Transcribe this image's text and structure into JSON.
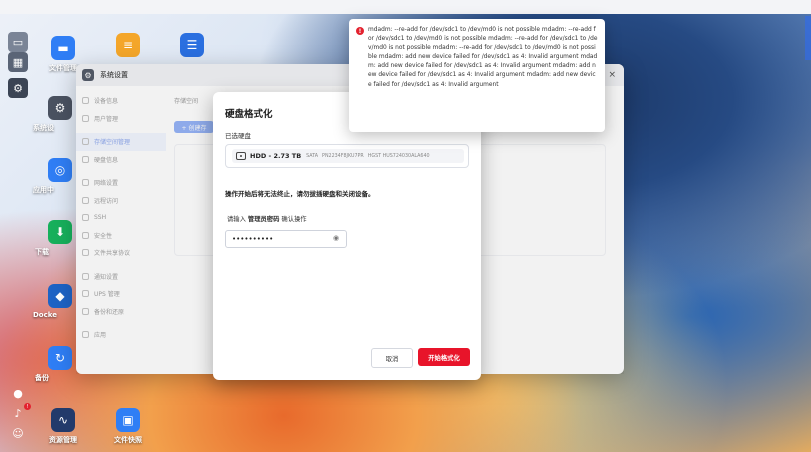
{
  "desktop": {
    "icons": [
      {
        "label": "文件管理",
        "icon": "folder-icon",
        "color": "#2f7ef5"
      },
      {
        "label": "",
        "icon": "notes-icon",
        "color": "#f4a62a"
      },
      {
        "label": "",
        "icon": "server-icon",
        "color": "#2a6fe0"
      },
      {
        "label": "系统设",
        "icon": "gear-icon",
        "color": "#4a5261"
      },
      {
        "label": "应用中",
        "icon": "store-icon",
        "color": "#2f7ef5"
      },
      {
        "label": "下载",
        "icon": "download-icon",
        "color": "#17b05c"
      },
      {
        "label": "Docke",
        "icon": "docker-icon",
        "color": "#1e63c5"
      },
      {
        "label": "备份",
        "icon": "backup-icon",
        "color": "#2f7ef5"
      },
      {
        "label": "资源管理",
        "icon": "monitor-icon",
        "color": "#223a6b"
      },
      {
        "label": "文件快照",
        "icon": "snapshot-icon",
        "color": "#2f7ef5"
      }
    ]
  },
  "window": {
    "title": "系统设置",
    "close": "×",
    "nav": [
      "设备信息",
      "用户管理",
      "存储空间管理",
      "硬盘信息",
      "网络设置",
      "远程访问",
      "SSH",
      "安全性",
      "文件共享协议",
      "通知设置",
      "UPS 管理",
      "备份和还原",
      "应用"
    ],
    "tab": "存储空间",
    "add_button": "+ 创建存"
  },
  "modal": {
    "title": "硬盘格式化",
    "selected_label": "已选硬盘",
    "disk_name": "HDD - 2.73 TB",
    "disk_interface": "SATA",
    "disk_serial": "PN2234F8JKU7PR",
    "disk_model": "HGST HUS724030ALA640",
    "warning": "操作开始后将无法终止，请勿拔插硬盘和关闭设备。",
    "prompt_prefix": "请输入",
    "prompt_bold": "管理员密码",
    "prompt_suffix": "确认操作",
    "password_value": "••••••••••",
    "cancel": "取消",
    "start": "开始格式化",
    "start_color": "#e8142a"
  },
  "toast": {
    "message": "mdadm: --re-add for /dev/sdc1 to /dev/md0 is not possible mdadm: --re-add for /dev/sdc1 to /dev/md0 is not possible mdadm: --re-add for /dev/sdc1 to /dev/md0 is not possible mdadm: --re-add for /dev/sdc1 to /dev/md0 is not possible mdadm: add new device failed for /dev/sdc1 as 4: Invalid argument mdadm: add new device failed for /dev/sdc1 as 4: Invalid argument mdadm: add new device failed for /dev/sdc1 as 4: Invalid argument mdadm: add new device failed for /dev/sdc1 as 4: Invalid argument",
    "color": "#e3222f"
  }
}
